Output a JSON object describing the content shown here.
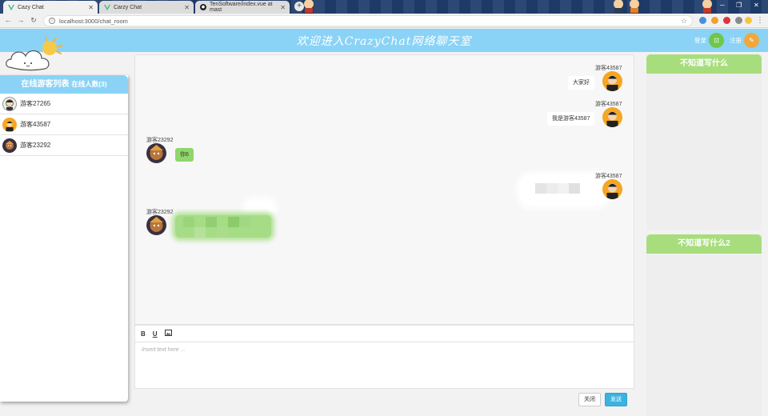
{
  "browser": {
    "tabs": [
      {
        "title": "Cazy Chat",
        "active": true
      },
      {
        "title": "Carzy Chat",
        "active": false
      },
      {
        "title": "TenSoftware/index.vue at mast",
        "active": false
      }
    ],
    "url": "localhost:3000/chat_room"
  },
  "header": {
    "title": "欢迎进入CrazyChat网络聊天室",
    "login": "登录",
    "register": "注册"
  },
  "online": {
    "title": "在线游客列表",
    "count_label": "在线人数(3)",
    "users": [
      {
        "name": "游客27265",
        "avatar": "man-face-icon"
      },
      {
        "name": "游客43587",
        "avatar": "man-orange-icon"
      },
      {
        "name": "游客23292",
        "avatar": "warrior-icon"
      }
    ]
  },
  "messages": [
    {
      "sender": "游客43587",
      "text": "大家好",
      "side": "right"
    },
    {
      "sender": "游客43587",
      "text": "我是游客43587",
      "side": "right"
    },
    {
      "sender": "游客23292",
      "text": "你6",
      "side": "left"
    },
    {
      "sender": "游客43587",
      "text": "",
      "side": "right"
    },
    {
      "sender": "游客23292",
      "text": "",
      "side": "left"
    }
  ],
  "editor": {
    "bold": "B",
    "underline": "U",
    "placeholder": "Insert text here ...",
    "close_label": "关闭",
    "send_label": "发送"
  },
  "right": {
    "panel1_title": "不知道写什么",
    "panel2_title": "不知道写什么2"
  },
  "colors": {
    "header_blue": "#8ad3f6",
    "right_green": "#a8dd7d",
    "bubble_green": "#8fd66b",
    "send_blue": "#3bb3e0"
  }
}
